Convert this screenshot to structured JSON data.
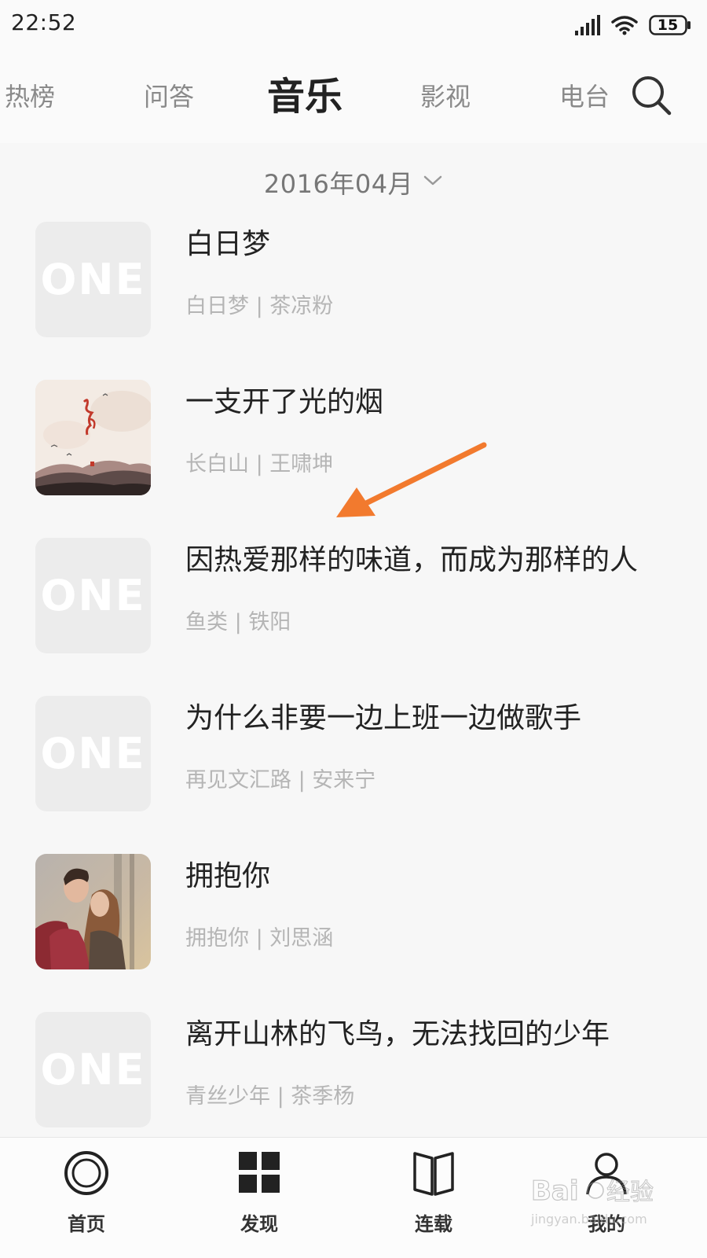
{
  "status_bar": {
    "time": "22:52",
    "battery_level": "15",
    "icons": [
      "signal-icon",
      "wifi-icon",
      "battery-icon"
    ]
  },
  "tabs": [
    {
      "label": "热榜",
      "active": false
    },
    {
      "label": "问答",
      "active": false
    },
    {
      "label": "音乐",
      "active": true
    },
    {
      "label": "影视",
      "active": false
    },
    {
      "label": "电台",
      "active": false
    }
  ],
  "search_icon": "search-icon",
  "date_selector": {
    "label": "2016年04月",
    "icon": "chevron-down-icon"
  },
  "music_items": [
    {
      "title": "白日梦",
      "subtitle": "白日梦 | 茶凉粉",
      "cover": "placeholder"
    },
    {
      "title": "一支开了光的烟",
      "subtitle": "长白山 | 王啸坤",
      "cover": "landscape-painting"
    },
    {
      "title": "因热爱那样的味道，而成为那样的人",
      "subtitle": "鱼类 | 铁阳",
      "cover": "placeholder"
    },
    {
      "title": "为什么非要一边上班一边做歌手",
      "subtitle": "再见文汇路 | 安来宁",
      "cover": "placeholder"
    },
    {
      "title": "拥抱你",
      "subtitle": "拥抱你 | 刘思涵",
      "cover": "couple-photo"
    },
    {
      "title": "离开山林的飞鸟，无法找回的少年",
      "subtitle": "青丝少年 | 茶季杨",
      "cover": "placeholder"
    }
  ],
  "cover_placeholder_text": "ONE",
  "annotation": {
    "type": "arrow",
    "color": "#f27a2e"
  },
  "bottom_nav": [
    {
      "label": "首页",
      "icon": "home-ring-icon"
    },
    {
      "label": "发现",
      "icon": "grid-icon"
    },
    {
      "label": "连载",
      "icon": "book-icon"
    },
    {
      "label": "我的",
      "icon": "person-icon"
    }
  ],
  "watermark": "Baidu经验 jingyan.baidu.com"
}
